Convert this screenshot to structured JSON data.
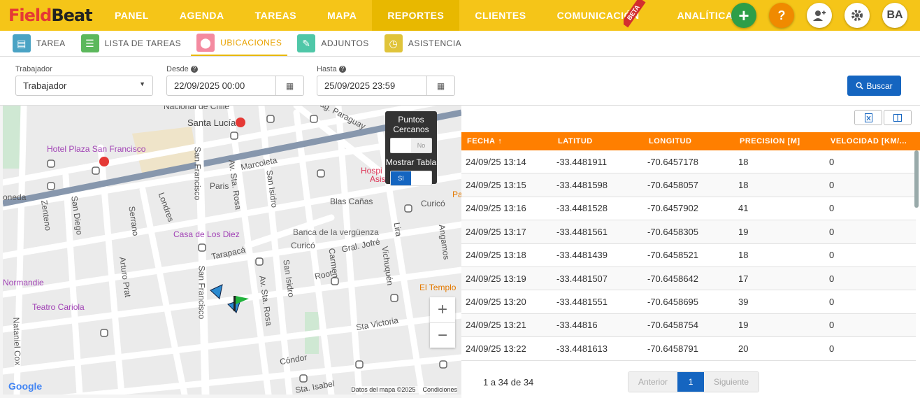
{
  "app": {
    "logo_field": "Field",
    "logo_beat": "Beat"
  },
  "nav": [
    {
      "label": "PANEL"
    },
    {
      "label": "AGENDA"
    },
    {
      "label": "TAREAS"
    },
    {
      "label": "MAPA"
    },
    {
      "label": "REPORTES"
    },
    {
      "label": "CLIENTES"
    },
    {
      "label": "COMUNICACIÓN"
    },
    {
      "label": "ANALÍTICA"
    }
  ],
  "beta_label": "BETA",
  "avatar_initials": "BA",
  "subtabs": [
    {
      "label": "TAREA",
      "color": "#4aa3c4"
    },
    {
      "label": "LISTA DE TAREAS",
      "color": "#5cb85c"
    },
    {
      "label": "UBICACIONES",
      "color": "#f48aa0"
    },
    {
      "label": "ADJUNTOS",
      "color": "#4fc7a8"
    },
    {
      "label": "ASISTENCIA",
      "color": "#e0c43a"
    }
  ],
  "filters": {
    "worker_label": "Trabajador",
    "worker_value": "Trabajador",
    "from_label": "Desde",
    "from_value": "22/09/2025 00:00",
    "to_label": "Hasta",
    "to_value": "25/09/2025 23:59",
    "search_label": "Buscar"
  },
  "map": {
    "overlay_nearby": "Puntos Cercanos",
    "overlay_nearby_state": "No",
    "overlay_table": "Mostrar Tabla",
    "overlay_table_state": "SI",
    "streets": [
      "Nacional de Chile",
      "Santa Lucía",
      "Diag. Paraguay",
      "Marcoleta",
      "Paris",
      "Blas Cañas",
      "Curicó",
      "San Francisco",
      "Av. Sta. Rosa",
      "San Isidro",
      "Serrano",
      "San Diego",
      "Londres",
      "Lira",
      "Tarapacá",
      "Root",
      "Gral. Jofré",
      "Carmen",
      "Vichuquén",
      "Angamos",
      "Arturo Prat",
      "Sta Victoria",
      "Cóndor",
      "Sta. Isabel",
      "Zenteno",
      "Nataniel Cox",
      "oneda"
    ],
    "pois": [
      "Hotel Plaza San Francisco",
      "Casa de Los Diez",
      "Banca de la vergüenza",
      "Normandie",
      "Teatro Cariola",
      "El Templo",
      "Hospi",
      "Asis",
      "Pa"
    ],
    "footer_data": "Datos del mapa ©2025",
    "footer_terms": "Condiciones",
    "google": "Google"
  },
  "table": {
    "columns": [
      "FECHA",
      "LATITUD",
      "LONGITUD",
      "PRECISION [M]",
      "VELOCIDAD [KM/..."
    ],
    "rows": [
      [
        "24/09/25 13:14",
        "-33.4481911",
        "-70.6457178",
        "18",
        "0"
      ],
      [
        "24/09/25 13:15",
        "-33.4481598",
        "-70.6458057",
        "18",
        "0"
      ],
      [
        "24/09/25 13:16",
        "-33.4481528",
        "-70.6457902",
        "41",
        "0"
      ],
      [
        "24/09/25 13:17",
        "-33.4481561",
        "-70.6458305",
        "19",
        "0"
      ],
      [
        "24/09/25 13:18",
        "-33.4481439",
        "-70.6458521",
        "18",
        "0"
      ],
      [
        "24/09/25 13:19",
        "-33.4481507",
        "-70.6458642",
        "17",
        "0"
      ],
      [
        "24/09/25 13:20",
        "-33.4481551",
        "-70.6458695",
        "39",
        "0"
      ],
      [
        "24/09/25 13:21",
        "-33.44816",
        "-70.6458754",
        "19",
        "0"
      ],
      [
        "24/09/25 13:22",
        "-33.4481613",
        "-70.6458791",
        "20",
        "0"
      ]
    ],
    "count_text": "1 a 34 de 34",
    "prev": "Anterior",
    "page": "1",
    "next": "Siguiente"
  }
}
